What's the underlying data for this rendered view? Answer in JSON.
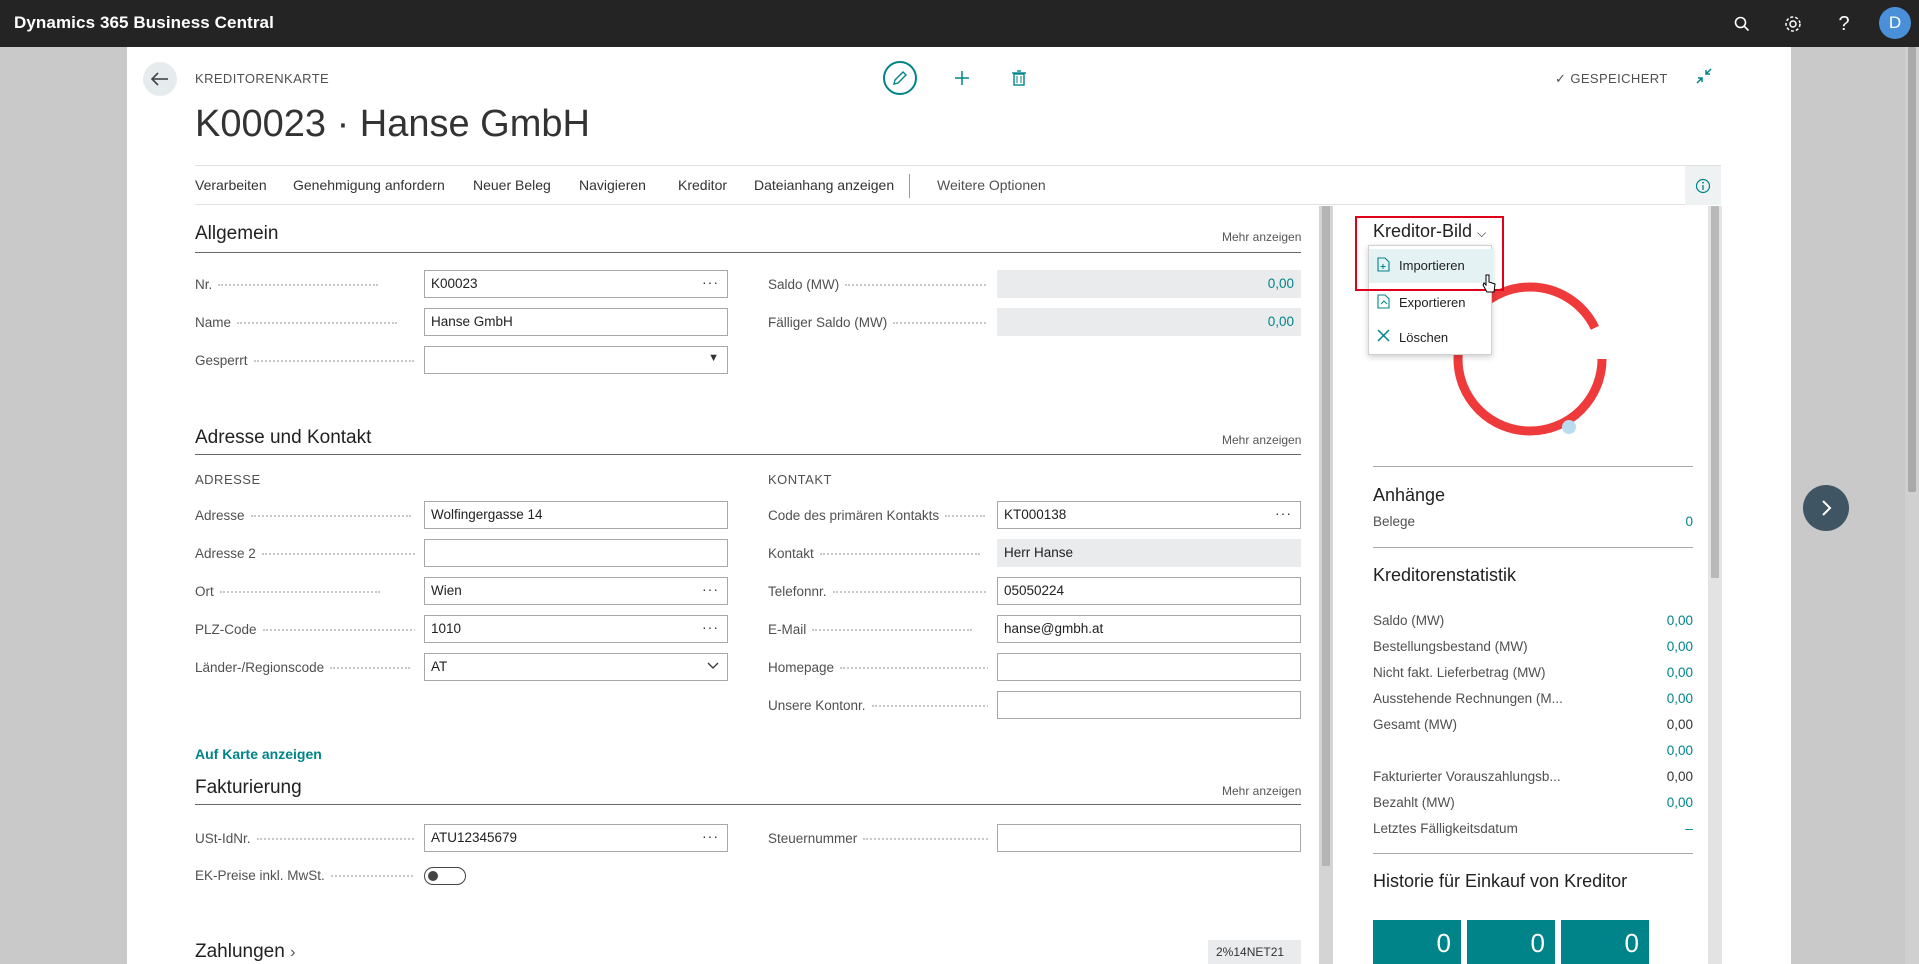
{
  "topbar": {
    "app_title": "Dynamics 365 Business Central",
    "avatar_initial": "D",
    "icons": [
      "search-icon",
      "gear-icon",
      "help-icon"
    ]
  },
  "header": {
    "breadcrumb": "KREDITORENKARTE",
    "title": "K00023 · Hanse GmbH",
    "saved_status": "GESPEICHERT"
  },
  "actions": {
    "items": [
      "Verarbeiten",
      "Genehmigung anfordern",
      "Neuer Beleg",
      "Navigieren",
      "Kreditor",
      "Dateianhang anzeigen"
    ],
    "more": "Weitere Optionen"
  },
  "allgemein": {
    "title": "Allgemein",
    "more": "Mehr anzeigen",
    "fields": [
      {
        "label": "Nr.",
        "value": "K00023"
      },
      {
        "label": "Name",
        "value": "Hanse GmbH"
      },
      {
        "label": "Gesperrt",
        "value": ""
      }
    ],
    "right_fields": [
      {
        "label": "Saldo (MW)",
        "value": "0,00"
      },
      {
        "label": "Fälliger Saldo (MW)",
        "value": "0,00"
      }
    ]
  },
  "adresse": {
    "title": "Adresse und Kontakt",
    "more": "Mehr anzeigen",
    "left_head": "ADRESSE",
    "right_head": "KONTAKT",
    "left_fields": [
      {
        "label": "Adresse",
        "value": "Wolfingergasse 14"
      },
      {
        "label": "Adresse 2",
        "value": ""
      },
      {
        "label": "Ort",
        "value": "Wien"
      },
      {
        "label": "PLZ-Code",
        "value": "1010"
      },
      {
        "label": "Länder-/Regionscode",
        "value": "AT"
      }
    ],
    "right_fields": [
      {
        "label": "Code des primären Kontakts",
        "value": "KT000138"
      },
      {
        "label": "Kontakt",
        "value": "Herr Hanse"
      },
      {
        "label": "Telefonnr.",
        "value": "05050224"
      },
      {
        "label": "E-Mail",
        "value": "hanse@gmbh.at"
      },
      {
        "label": "Homepage",
        "value": ""
      },
      {
        "label": "Unsere Kontonr.",
        "value": ""
      }
    ],
    "map_link": "Auf Karte anzeigen"
  },
  "fakturierung": {
    "title": "Fakturierung",
    "more": "Mehr anzeigen",
    "fields": [
      {
        "label": "USt-IdNr.",
        "value": "ATU12345679"
      },
      {
        "label": "EK-Preise inkl. MwSt.",
        "value": ""
      }
    ],
    "right_fields": [
      {
        "label": "Steuernummer",
        "value": ""
      }
    ]
  },
  "zahlungen": {
    "title": "Zahlungen",
    "term": "2%14NET21"
  },
  "factbox": {
    "picture_title": "Kreditor-Bild",
    "menu": [
      "Importieren",
      "Exportieren",
      "Löschen"
    ],
    "attachments": {
      "title": "Anhänge",
      "label": "Belege",
      "value": "0"
    },
    "stats": {
      "title": "Kreditorenstatistik",
      "rows": [
        {
          "label": "Saldo (MW)",
          "value": "0,00"
        },
        {
          "label": "Bestellungsbestand (MW)",
          "value": "0,00"
        },
        {
          "label": "Nicht fakt. Lieferbetrag (MW)",
          "value": "0,00"
        },
        {
          "label": "Ausstehende Rechnungen (M...",
          "value": "0,00"
        },
        {
          "label": "Gesamt (MW)",
          "value": "0,00"
        },
        {
          "label": "",
          "value": "0,00"
        },
        {
          "label": "Fakturierter Vorauszahlungsb...",
          "value": "0,00"
        },
        {
          "label": "Bezahlt (MW)",
          "value": "0,00"
        },
        {
          "label": "Letztes Fälligkeitsdatum",
          "value": "–"
        }
      ]
    },
    "history": {
      "title": "Historie für Einkauf von Kreditor",
      "tiles": [
        "0",
        "0",
        "0"
      ]
    }
  },
  "colors": {
    "accent": "#008489",
    "topbar": "#242424",
    "highlight": "#e0001b"
  }
}
